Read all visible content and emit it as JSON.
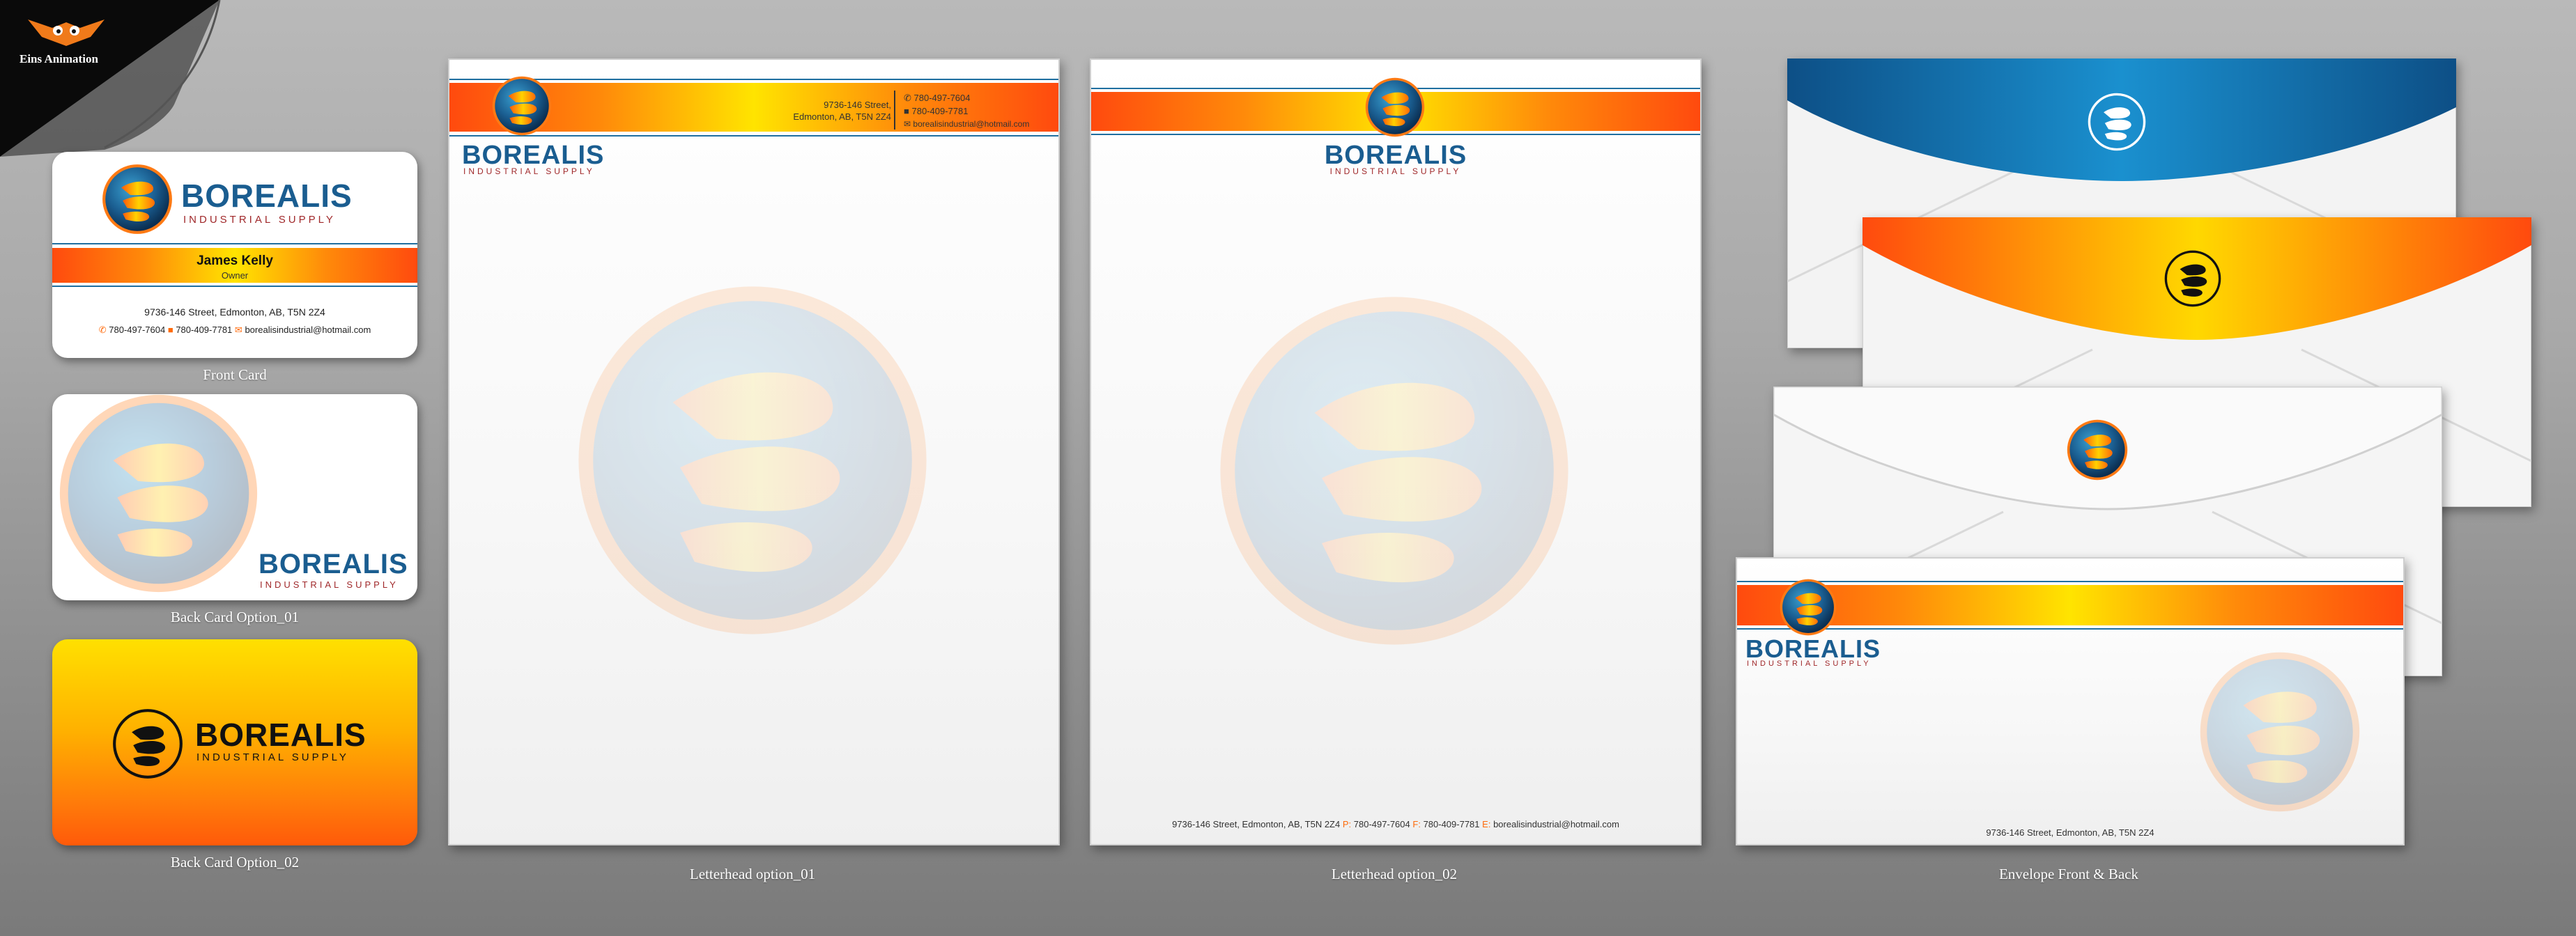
{
  "studio": {
    "name": "Eins Animation"
  },
  "colors": {
    "orange": "#ff6a0a",
    "yellow": "#ffe400",
    "blue": "#1a5d90",
    "envelope_blue": "#1a86c4"
  },
  "brand": {
    "name": "BOREALIS",
    "tagline": "INDUSTRIAL SUPPLY"
  },
  "contact": {
    "address_line1": "9736-146 Street,",
    "address_line2": "Edmonton, AB, T5N 2Z4",
    "address_full": "9736-146 Street, Edmonton, AB, T5N 2Z4",
    "phone": "780-497-7604",
    "fax": "780-409-7781",
    "email": "borealisindustrial@hotmail.com"
  },
  "front_card": {
    "person_name": "James Kelly",
    "person_title": "Owner"
  },
  "letterhead2_footer": {
    "address": "9736-146 Street, Edmonton, AB, T5N 2Z4",
    "p_label": "P:",
    "phone": "780-497-7604",
    "f_label": "F:",
    "fax": "780-409-7781",
    "e_label": "E:",
    "email": "borealisindustrial@hotmail.com"
  },
  "captions": {
    "front_card": "Front Card",
    "back_card_1": "Back Card Option_01",
    "back_card_2": "Back Card Option_02",
    "letterhead_1": "Letterhead option_01",
    "letterhead_2": "Letterhead option_02",
    "envelope": "Envelope Front & Back"
  },
  "icons": [
    "studio-mascot-icon",
    "borealis-logo-icon",
    "phone-icon",
    "fax-icon",
    "email-icon"
  ]
}
